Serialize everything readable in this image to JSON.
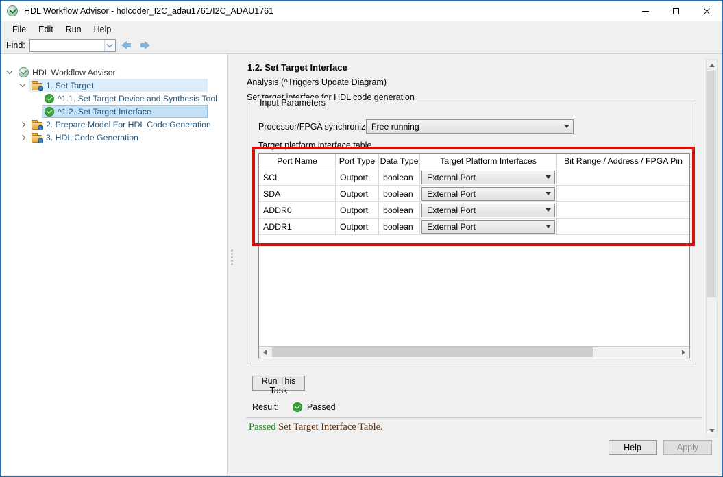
{
  "window": {
    "title": "HDL Workflow Advisor - hdlcoder_I2C_adau1761/I2C_ADAU1761"
  },
  "menubar": {
    "items": [
      "File",
      "Edit",
      "Run",
      "Help"
    ]
  },
  "findbar": {
    "label": "Find:",
    "value": ""
  },
  "tree": {
    "items": [
      {
        "label": "HDL Workflow Advisor",
        "state": "expanded",
        "icon": "advisor"
      },
      {
        "label": "1. Set Target",
        "state": "expanded",
        "icon": "task-folder",
        "highlighted": true
      },
      {
        "label": "^1.1. Set Target Device and Synthesis Tool",
        "state": "leaf",
        "icon": "passed-check"
      },
      {
        "label": "^1.2. Set Target Interface",
        "state": "leaf",
        "icon": "passed-check",
        "selected": true
      },
      {
        "label": "2. Prepare Model For HDL Code Generation",
        "state": "collapsed",
        "icon": "task-folder"
      },
      {
        "label": "3. HDL Code Generation",
        "state": "collapsed",
        "icon": "task-folder"
      }
    ]
  },
  "panel": {
    "heading": "1.2. Set Target Interface",
    "analysis": "Analysis (^Triggers Update Diagram)",
    "description": "Set target interface for HDL code generation",
    "group_label": "Input Parameters",
    "sync_label": "Processor/FPGA synchronization:",
    "sync_value": "Free running",
    "table_label": "Target platform interface table",
    "run_button": "Run This Task",
    "result_label": "Result:",
    "result_status": "Passed",
    "message_status": "Passed",
    "message_text": " Set Target Interface Table."
  },
  "table": {
    "headers": [
      "Port Name",
      "Port Type",
      "Data Type",
      "Target Platform Interfaces",
      "Bit Range / Address / FPGA Pin"
    ],
    "rows": [
      {
        "port_name": "SCL",
        "port_type": "Outport",
        "data_type": "boolean",
        "interface": "External Port",
        "bit_range": ""
      },
      {
        "port_name": "SDA",
        "port_type": "Outport",
        "data_type": "boolean",
        "interface": "External Port",
        "bit_range": ""
      },
      {
        "port_name": "ADDR0",
        "port_type": "Outport",
        "data_type": "boolean",
        "interface": "External Port",
        "bit_range": ""
      },
      {
        "port_name": "ADDR1",
        "port_type": "Outport",
        "data_type": "boolean",
        "interface": "External Port",
        "bit_range": ""
      }
    ]
  },
  "footer": {
    "help": "Help",
    "apply": "Apply"
  },
  "colors": {
    "window_border": "#2173b9",
    "highlight_annotation_red": "#d60f0f",
    "check_green": "#3aa23a",
    "passed_text_green": "#1e8a1e",
    "tree_selection_blue": "#c6e2f7",
    "tree_open_highlight_blue": "#dcedfb"
  }
}
